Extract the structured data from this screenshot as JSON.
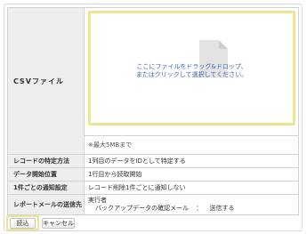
{
  "csv_file": {
    "label": "CSVファイル",
    "drop_line1": "ここにファイルをドラッグ&ドロップ、",
    "drop_line2": "またはクリックして選択してください。",
    "icon": "document-icon",
    "max_size_note": "※最大5MBまで"
  },
  "record_identification": {
    "label": "レコードの特定方法",
    "value": "1列目のデータをIDとして特定する"
  },
  "data_start": {
    "label": "データ開始位置",
    "value": "1行目から読取開始"
  },
  "per_record_notification": {
    "label": "1件ごとの通知設定",
    "value": "レコード削除1件ごとに通知しない"
  },
  "report_mail": {
    "label": "レポートメールの送信先",
    "line1": "実行者",
    "line2_label": "バックアップデータの確認メール",
    "line2_sep": "：",
    "line2_value": "送信する"
  },
  "buttons": {
    "submit": "読込",
    "cancel": "キャンセル"
  },
  "colors": {
    "highlight": "#eee590",
    "link_text": "#3a67b5",
    "label_bg": "#eeeeee"
  }
}
